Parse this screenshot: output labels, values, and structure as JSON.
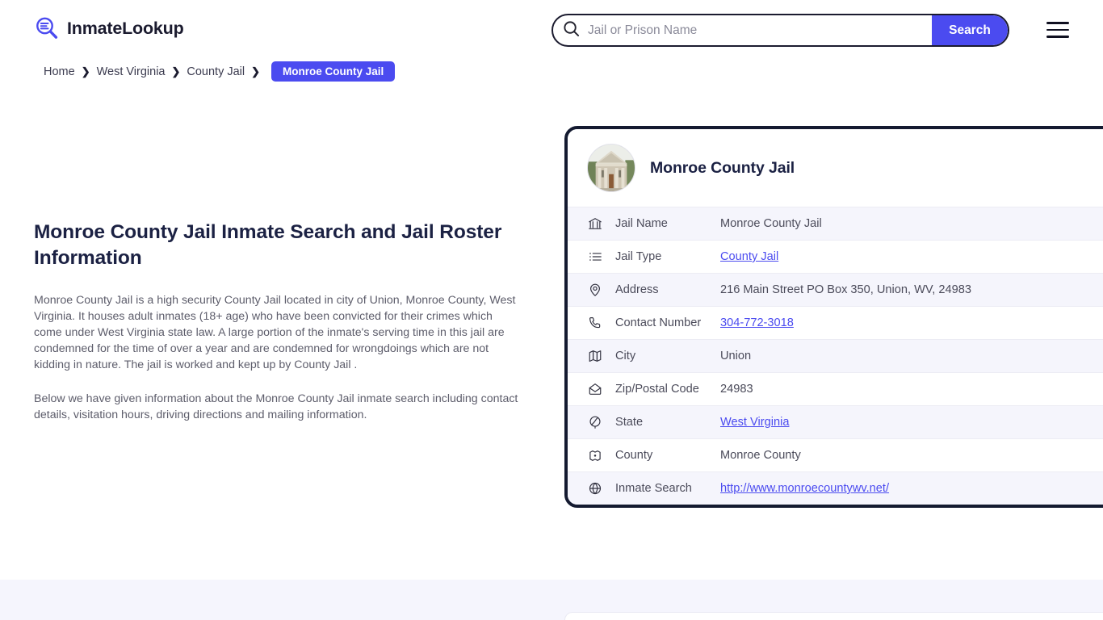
{
  "header": {
    "logo_text": "InmateLookup",
    "logo_icon": "magnifier-list-icon",
    "search": {
      "placeholder": "Jail or Prison Name",
      "value": "",
      "button_label": "Search",
      "icon": "search-icon"
    },
    "menu_icon": "hamburger-menu-icon"
  },
  "breadcrumb": {
    "items": [
      {
        "label": "Home",
        "current": false
      },
      {
        "label": "West Virginia",
        "current": false
      },
      {
        "label": "County Jail",
        "current": false
      },
      {
        "label": "Monroe County Jail",
        "current": true
      }
    ],
    "separator": "❯"
  },
  "article": {
    "title": "Monroe County Jail Inmate Search and Jail Roster Information",
    "paragraph1": "Monroe County Jail is a high security County Jail located in city of Union, Monroe County, West Virginia. It houses adult inmates (18+ age) who have been convicted for their crimes which come under West Virginia state law. A large portion of the inmate's serving time in this jail are condemned for the time of over a year and are condemned for wrongdoings which are not kidding in nature. The jail is worked and kept up by County Jail .",
    "paragraph2": "Below we have given information about the Monroe County Jail inmate search including contact details, visitation hours, driving directions and mailing information."
  },
  "info_card": {
    "avatar_icon": "courthouse-photo",
    "title": "Monroe County Jail",
    "rows": [
      {
        "icon": "bank-icon",
        "label": "Jail Name",
        "value": "Monroe County Jail",
        "link": false
      },
      {
        "icon": "list-icon",
        "label": "Jail Type",
        "value": "County Jail",
        "link": true
      },
      {
        "icon": "map-pin-icon",
        "label": "Address",
        "value": "216 Main Street PO Box 350, Union, WV, 24983",
        "link": false
      },
      {
        "icon": "phone-icon",
        "label": "Contact Number",
        "value": "304-772-3018",
        "link": true
      },
      {
        "icon": "map-icon",
        "label": "City",
        "value": "Union",
        "link": false
      },
      {
        "icon": "envelope-icon",
        "label": "Zip/Postal Code",
        "value": "24983",
        "link": false
      },
      {
        "icon": "globe-stand-icon",
        "label": "State",
        "value": "West Virginia",
        "link": true
      },
      {
        "icon": "region-pin-icon",
        "label": "County",
        "value": "Monroe County",
        "link": false
      },
      {
        "icon": "globe-icon",
        "label": "Inmate Search",
        "value": "http://www.monroecountywv.net/",
        "link": true
      }
    ]
  },
  "colors": {
    "accent_blue": "#4b4bf0",
    "card_border": "#141a30",
    "heading": "#1b2143",
    "body_text": "#5d5d6b",
    "row_alt_bg": "#f5f5fc",
    "band_bg": "#f5f5fd"
  }
}
